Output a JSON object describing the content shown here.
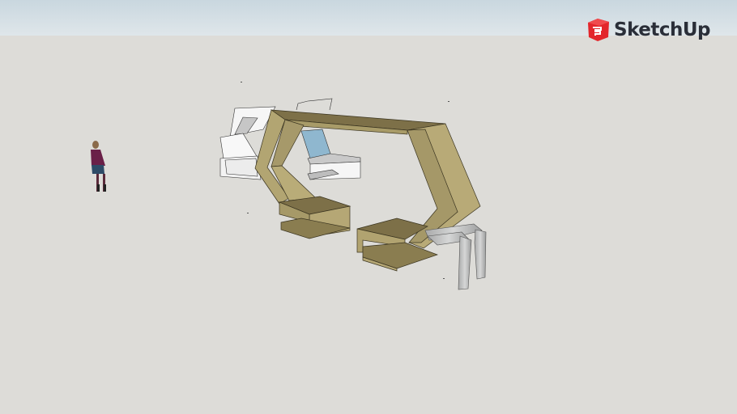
{
  "app": {
    "brand": "SketchUp",
    "brand_color": "#e3262b"
  },
  "scene": {
    "description_colors": {
      "wood": "#b5a775",
      "wood_dark": "#8a7d50",
      "white": "#f7f7f7",
      "glass": "#8fb7cf",
      "metal": "#c5c6c6"
    }
  }
}
